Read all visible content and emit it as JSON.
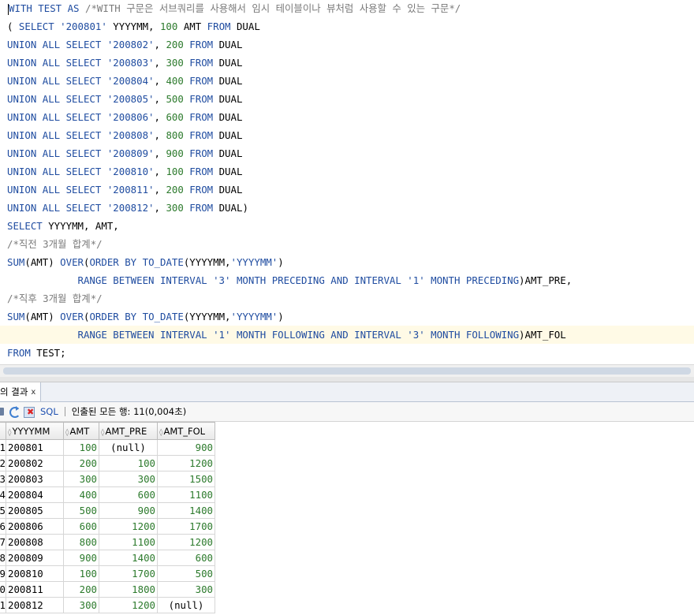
{
  "editor": {
    "lines": [
      [
        {
          "t": "WITH TEST AS ",
          "c": "kw"
        },
        {
          "t": "/*WITH 구문은 서브쿼리를 사용해서 임시 테이블이나 뷰처럼 사용할 수 있는 구문*/",
          "c": "cmt"
        }
      ],
      [
        {
          "t": "( ",
          "c": ""
        },
        {
          "t": "SELECT ",
          "c": "kw"
        },
        {
          "t": "'200801'",
          "c": "str"
        },
        {
          "t": " YYYYMM, ",
          "c": ""
        },
        {
          "t": "100",
          "c": "num"
        },
        {
          "t": " AMT ",
          "c": ""
        },
        {
          "t": "FROM",
          "c": "kw"
        },
        {
          "t": " DUAL",
          "c": ""
        }
      ],
      [
        {
          "t": "UNION ALL SELECT ",
          "c": "kw"
        },
        {
          "t": "'200802'",
          "c": "str"
        },
        {
          "t": ", ",
          "c": ""
        },
        {
          "t": "200",
          "c": "num"
        },
        {
          "t": " ",
          "c": ""
        },
        {
          "t": "FROM",
          "c": "kw"
        },
        {
          "t": " DUAL",
          "c": ""
        }
      ],
      [
        {
          "t": "UNION ALL SELECT ",
          "c": "kw"
        },
        {
          "t": "'200803'",
          "c": "str"
        },
        {
          "t": ", ",
          "c": ""
        },
        {
          "t": "300",
          "c": "num"
        },
        {
          "t": " ",
          "c": ""
        },
        {
          "t": "FROM",
          "c": "kw"
        },
        {
          "t": " DUAL",
          "c": ""
        }
      ],
      [
        {
          "t": "UNION ALL SELECT ",
          "c": "kw"
        },
        {
          "t": "'200804'",
          "c": "str"
        },
        {
          "t": ", ",
          "c": ""
        },
        {
          "t": "400",
          "c": "num"
        },
        {
          "t": " ",
          "c": ""
        },
        {
          "t": "FROM",
          "c": "kw"
        },
        {
          "t": " DUAL",
          "c": ""
        }
      ],
      [
        {
          "t": "UNION ALL SELECT ",
          "c": "kw"
        },
        {
          "t": "'200805'",
          "c": "str"
        },
        {
          "t": ", ",
          "c": ""
        },
        {
          "t": "500",
          "c": "num"
        },
        {
          "t": " ",
          "c": ""
        },
        {
          "t": "FROM",
          "c": "kw"
        },
        {
          "t": " DUAL",
          "c": ""
        }
      ],
      [
        {
          "t": "UNION ALL SELECT ",
          "c": "kw"
        },
        {
          "t": "'200806'",
          "c": "str"
        },
        {
          "t": ", ",
          "c": ""
        },
        {
          "t": "600",
          "c": "num"
        },
        {
          "t": " ",
          "c": ""
        },
        {
          "t": "FROM",
          "c": "kw"
        },
        {
          "t": " DUAL",
          "c": ""
        }
      ],
      [
        {
          "t": "UNION ALL SELECT ",
          "c": "kw"
        },
        {
          "t": "'200808'",
          "c": "str"
        },
        {
          "t": ", ",
          "c": ""
        },
        {
          "t": "800",
          "c": "num"
        },
        {
          "t": " ",
          "c": ""
        },
        {
          "t": "FROM",
          "c": "kw"
        },
        {
          "t": " DUAL",
          "c": ""
        }
      ],
      [
        {
          "t": "UNION ALL SELECT ",
          "c": "kw"
        },
        {
          "t": "'200809'",
          "c": "str"
        },
        {
          "t": ", ",
          "c": ""
        },
        {
          "t": "900",
          "c": "num"
        },
        {
          "t": " ",
          "c": ""
        },
        {
          "t": "FROM",
          "c": "kw"
        },
        {
          "t": " DUAL",
          "c": ""
        }
      ],
      [
        {
          "t": "UNION ALL SELECT ",
          "c": "kw"
        },
        {
          "t": "'200810'",
          "c": "str"
        },
        {
          "t": ", ",
          "c": ""
        },
        {
          "t": "100",
          "c": "num"
        },
        {
          "t": " ",
          "c": ""
        },
        {
          "t": "FROM",
          "c": "kw"
        },
        {
          "t": " DUAL",
          "c": ""
        }
      ],
      [
        {
          "t": "UNION ALL SELECT ",
          "c": "kw"
        },
        {
          "t": "'200811'",
          "c": "str"
        },
        {
          "t": ", ",
          "c": ""
        },
        {
          "t": "200",
          "c": "num"
        },
        {
          "t": " ",
          "c": ""
        },
        {
          "t": "FROM",
          "c": "kw"
        },
        {
          "t": " DUAL",
          "c": ""
        }
      ],
      [
        {
          "t": "UNION ALL SELECT ",
          "c": "kw"
        },
        {
          "t": "'200812'",
          "c": "str"
        },
        {
          "t": ", ",
          "c": ""
        },
        {
          "t": "300",
          "c": "num"
        },
        {
          "t": " ",
          "c": ""
        },
        {
          "t": "FROM",
          "c": "kw"
        },
        {
          "t": " DUAL)",
          "c": ""
        }
      ],
      [
        {
          "t": "SELECT",
          "c": "kw"
        },
        {
          "t": " YYYYMM, AMT,",
          "c": ""
        }
      ],
      [
        {
          "t": "/*직전 3개월 합계*/",
          "c": "cmt"
        }
      ],
      [
        {
          "t": "SUM",
          "c": "kw"
        },
        {
          "t": "(AMT) ",
          "c": ""
        },
        {
          "t": "OVER",
          "c": "kw"
        },
        {
          "t": "(",
          "c": ""
        },
        {
          "t": "ORDER BY TO_DATE",
          "c": "kw"
        },
        {
          "t": "(YYYYMM,",
          "c": ""
        },
        {
          "t": "'YYYYMM'",
          "c": "str"
        },
        {
          "t": ")",
          "c": ""
        }
      ],
      [
        {
          "t": "            RANGE BETWEEN INTERVAL ",
          "c": "kw"
        },
        {
          "t": "'3'",
          "c": "str"
        },
        {
          "t": " MONTH PRECEDING AND INTERVAL ",
          "c": "kw"
        },
        {
          "t": "'1'",
          "c": "str"
        },
        {
          "t": " MONTH PRECEDING",
          "c": "kw"
        },
        {
          "t": ")AMT_PRE,",
          "c": ""
        }
      ],
      [
        {
          "t": "/*직후 3개월 합계*/",
          "c": "cmt"
        }
      ],
      [
        {
          "t": "SUM",
          "c": "kw"
        },
        {
          "t": "(AMT) ",
          "c": ""
        },
        {
          "t": "OVER",
          "c": "kw"
        },
        {
          "t": "(",
          "c": ""
        },
        {
          "t": "ORDER BY TO_DATE",
          "c": "kw"
        },
        {
          "t": "(YYYYMM,",
          "c": ""
        },
        {
          "t": "'YYYYMM'",
          "c": "str"
        },
        {
          "t": ")",
          "c": ""
        }
      ],
      [
        {
          "t": "            RANGE BETWEEN INTERVAL ",
          "c": "kw"
        },
        {
          "t": "'1'",
          "c": "str"
        },
        {
          "t": " MONTH FOLLOWING AND INTERVAL ",
          "c": "kw"
        },
        {
          "t": "'3'",
          "c": "str"
        },
        {
          "t": " MONTH FOLLOWING",
          "c": "kw"
        },
        {
          "t": ")AMT_FOL",
          "c": ""
        }
      ],
      [
        {
          "t": "FROM",
          "c": "kw"
        },
        {
          "t": " TEST;",
          "c": ""
        }
      ]
    ],
    "current_line_index": 18
  },
  "results_tab": {
    "label": "의 결과",
    "close": "x"
  },
  "toolbar": {
    "sql_label": "SQL",
    "separator": "|",
    "status": "인출된 모든 행: 11(0,004초)"
  },
  "grid": {
    "columns": [
      "YYYYMM",
      "AMT",
      "AMT_PRE",
      "AMT_FOL"
    ],
    "sort_glyph": "◊",
    "rows": [
      {
        "n": "1",
        "yyyymm": "200801",
        "amt": "100",
        "amt_pre": "(null)",
        "amt_fol": "900"
      },
      {
        "n": "2",
        "yyyymm": "200802",
        "amt": "200",
        "amt_pre": "100",
        "amt_fol": "1200"
      },
      {
        "n": "3",
        "yyyymm": "200803",
        "amt": "300",
        "amt_pre": "300",
        "amt_fol": "1500"
      },
      {
        "n": "4",
        "yyyymm": "200804",
        "amt": "400",
        "amt_pre": "600",
        "amt_fol": "1100"
      },
      {
        "n": "5",
        "yyyymm": "200805",
        "amt": "500",
        "amt_pre": "900",
        "amt_fol": "1400"
      },
      {
        "n": "6",
        "yyyymm": "200806",
        "amt": "600",
        "amt_pre": "1200",
        "amt_fol": "1700"
      },
      {
        "n": "7",
        "yyyymm": "200808",
        "amt": "800",
        "amt_pre": "1100",
        "amt_fol": "1200"
      },
      {
        "n": "8",
        "yyyymm": "200809",
        "amt": "900",
        "amt_pre": "1400",
        "amt_fol": "600"
      },
      {
        "n": "9",
        "yyyymm": "200810",
        "amt": "100",
        "amt_pre": "1700",
        "amt_fol": "500"
      },
      {
        "n": "0",
        "yyyymm": "200811",
        "amt": "200",
        "amt_pre": "1800",
        "amt_fol": "300"
      },
      {
        "n": "1",
        "yyyymm": "200812",
        "amt": "300",
        "amt_pre": "1200",
        "amt_fol": "(null)"
      }
    ]
  }
}
